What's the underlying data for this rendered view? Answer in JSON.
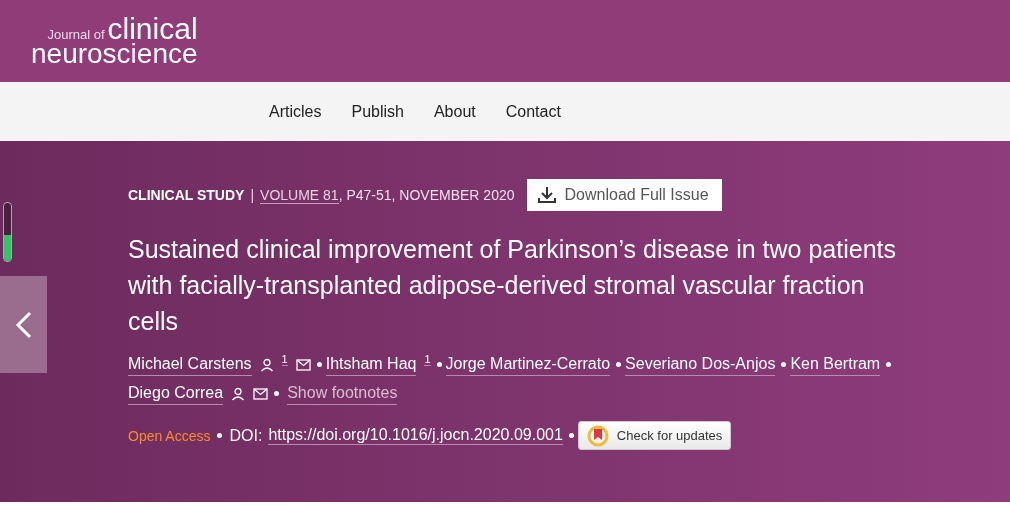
{
  "logo": {
    "small": "Journal of",
    "big": "clinical",
    "bottom": "neuroscience"
  },
  "nav": [
    "Articles",
    "Publish",
    "About",
    "Contact"
  ],
  "meter": {
    "level": 0.45
  },
  "article": {
    "type": "CLINICAL STUDY",
    "separator": "|",
    "volume": "VOLUME 81",
    "pages": ", P47-51, NOVEMBER 2020",
    "download": "Download Full Issue",
    "title": "Sustained clinical improvement of Parkinson’s disease in two patients with facially-transplanted adipose-derived stromal vascular fraction cells",
    "authors": [
      {
        "name": "Michael Carstens",
        "person": true,
        "sup": "1",
        "mail": true
      },
      {
        "name": "Ihtsham Haq",
        "person": false,
        "sup": "1",
        "mail": false
      },
      {
        "name": "Jorge Martinez-Cerrato",
        "person": false,
        "mail": false
      },
      {
        "name": "Severiano Dos-Anjos",
        "person": false,
        "mail": false
      },
      {
        "name": "Ken Bertram",
        "person": false,
        "mail": false
      },
      {
        "name": "Diego Correa",
        "person": true,
        "mail": true
      }
    ],
    "footnotes": "Show footnotes",
    "open_access": "Open Access",
    "doi_label": "DOI:",
    "doi": "https://doi.org/10.1016/j.jocn.2020.09.001",
    "updates": "Check for updates"
  }
}
